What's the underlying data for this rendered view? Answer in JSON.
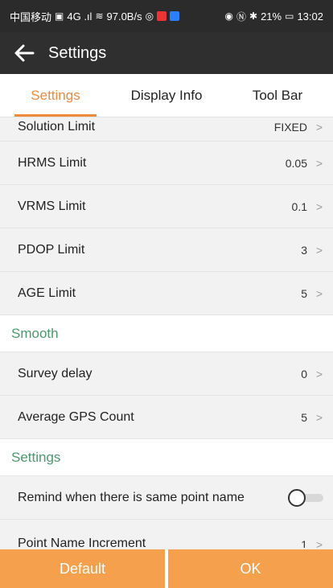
{
  "status_bar": {
    "carrier": "中国移动",
    "signal": "4G .ıl",
    "speed": "97.0B/s",
    "battery": "21%",
    "time": "13:02"
  },
  "header": {
    "title": "Settings"
  },
  "tabs": [
    {
      "label": "Settings",
      "active": true
    },
    {
      "label": "Display Info",
      "active": false
    },
    {
      "label": "Tool Bar",
      "active": false
    }
  ],
  "rows_limits": [
    {
      "label": "Solution Limit",
      "value": "FIXED"
    },
    {
      "label": "HRMS Limit",
      "value": "0.05"
    },
    {
      "label": "VRMS Limit",
      "value": "0.1"
    },
    {
      "label": "PDOP Limit",
      "value": "3"
    },
    {
      "label": "AGE Limit",
      "value": "5"
    }
  ],
  "section_smooth": "Smooth",
  "rows_smooth": [
    {
      "label": "Survey delay",
      "value": "0"
    },
    {
      "label": "Average GPS Count",
      "value": "5"
    }
  ],
  "section_settings": "Settings",
  "remind_row": {
    "label": "Remind when there is same point name",
    "enabled": false
  },
  "increment_row": {
    "label": "Point Name Increment",
    "value": "1"
  },
  "buttons": {
    "default": "Default",
    "ok": "OK"
  },
  "colors": {
    "accent": "#f08a3c",
    "section": "#4a9a6b",
    "button": "#f5a04d"
  }
}
